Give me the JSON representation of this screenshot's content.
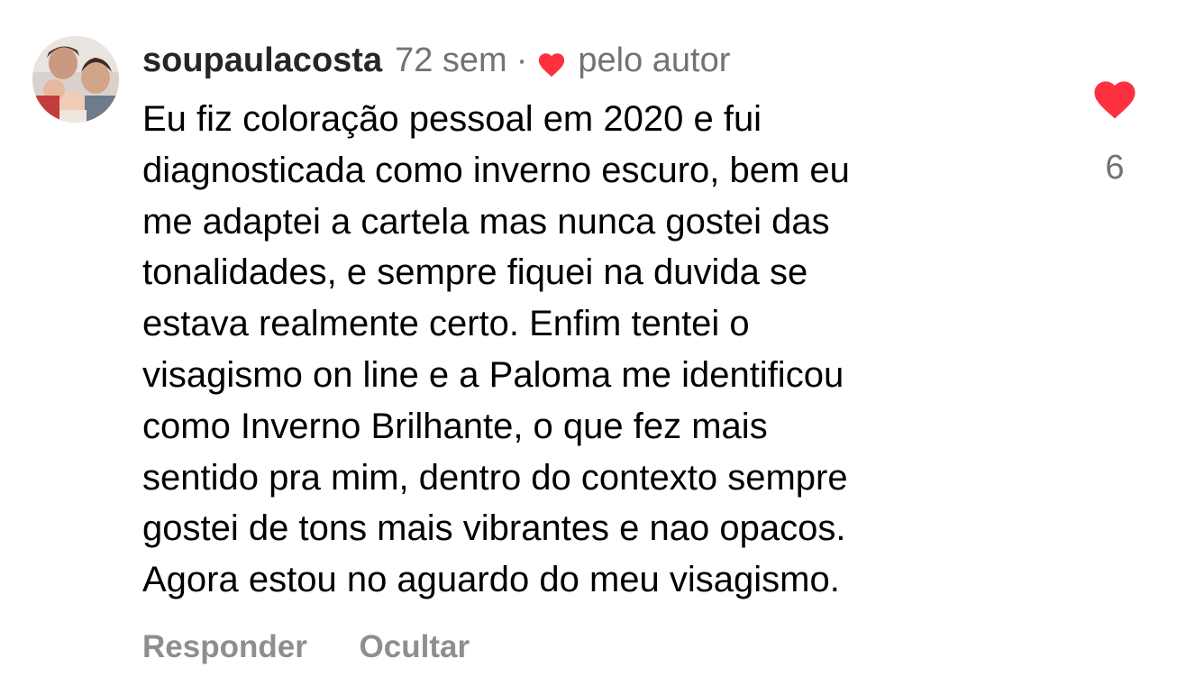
{
  "comment": {
    "username": "soupaulacosta",
    "timestamp": "72 sem",
    "separator": "·",
    "liked_by_author_label": "pelo autor",
    "text_lines": [
      "Eu fiz coloração pessoal em 2020 e fui",
      "diagnosticada como inverno escuro, bem eu",
      "me adaptei a cartela mas nunca gostei das",
      "tonalidades, e sempre fiquei na duvida se",
      "estava realmente certo. Enfim tentei o",
      "visagismo on line e a Paloma me identificou",
      "como Inverno Brilhante, o que fez mais",
      "sentido pra mim, dentro do contexto sempre",
      "gostei de tons mais vibrantes e nao opacos.",
      "Agora estou no aguardo do meu visagismo."
    ],
    "like_count": "6",
    "icons": {
      "author_heart": "heart-icon",
      "like": "heart-icon",
      "avatar": "profile-photo"
    },
    "colors": {
      "like_red": "#ff3040",
      "meta_gray": "#737373",
      "action_gray": "#8e8e8e"
    }
  },
  "actions": {
    "reply_label": "Responder",
    "hide_label": "Ocultar"
  }
}
